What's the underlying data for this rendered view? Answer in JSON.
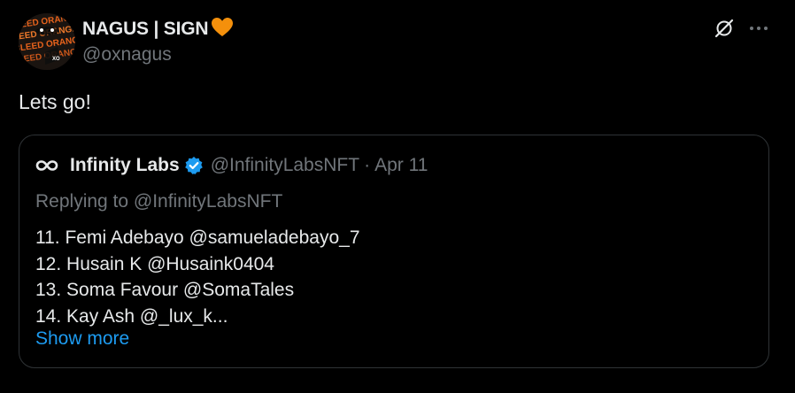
{
  "author": {
    "display_name": "NAGUS | SIGN",
    "handle": "@oxnagus",
    "avatar_text": [
      "BLEED ORANGE",
      "BLEED ORANGE",
      "BLEED ORANGE",
      "BLEED ORANGE",
      "XO"
    ]
  },
  "tweet": {
    "text": "Lets go!"
  },
  "quote": {
    "display_name": "Infinity Labs",
    "handle": "@InfinityLabsNFT",
    "separator": "·",
    "date": "Apr 11",
    "replying_to": "Replying to @InfinityLabsNFT",
    "lines": [
      "11. Femi Adebayo @samueladebayo_7",
      "12. Husain K @Husaink0404",
      "13. Soma Favour @SomaTales",
      "14. Kay Ash @_lux_k..."
    ],
    "show_more": "Show more"
  },
  "colors": {
    "background": "#000000",
    "text_primary": "#e7e9ea",
    "text_secondary": "#71767b",
    "link": "#1d9bf0",
    "border": "#2f3336",
    "heart": "#f4900c",
    "verified": "#1d9bf0"
  },
  "icons": {
    "header_action": "grok-slash-icon",
    "more": "more-horizontal-icon",
    "name_emoji": "orange-heart-icon",
    "verified": "verified-badge-icon",
    "quote_avatar": "infinity-logo-icon"
  }
}
